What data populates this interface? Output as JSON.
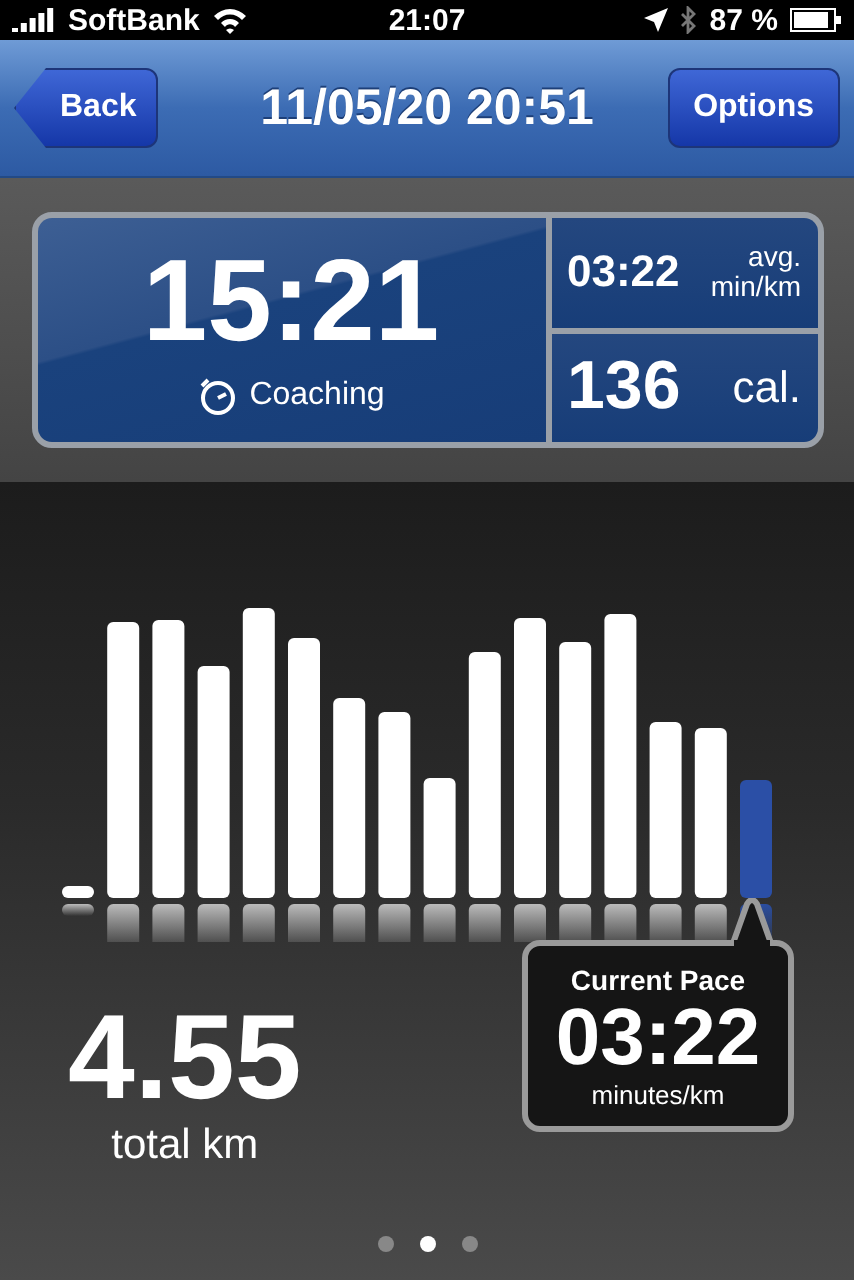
{
  "status_bar": {
    "carrier": "SoftBank",
    "time": "21:07",
    "battery": "87 %"
  },
  "nav": {
    "back": "Back",
    "title": "11/05/20 20:51",
    "options": "Options"
  },
  "summary": {
    "duration": "15:21",
    "mode": "Coaching",
    "avg_pace": "03:22",
    "avg_label": "avg.",
    "avg_unit": "min/km",
    "calories": "136",
    "calories_unit": "cal."
  },
  "distance": {
    "value": "4.55",
    "unit": "total km"
  },
  "current_pace": {
    "title": "Current Pace",
    "value": "03:22",
    "unit": "minutes/km"
  },
  "pager": [
    {
      "selected": false
    },
    {
      "selected": true
    },
    {
      "selected": false
    }
  ]
}
